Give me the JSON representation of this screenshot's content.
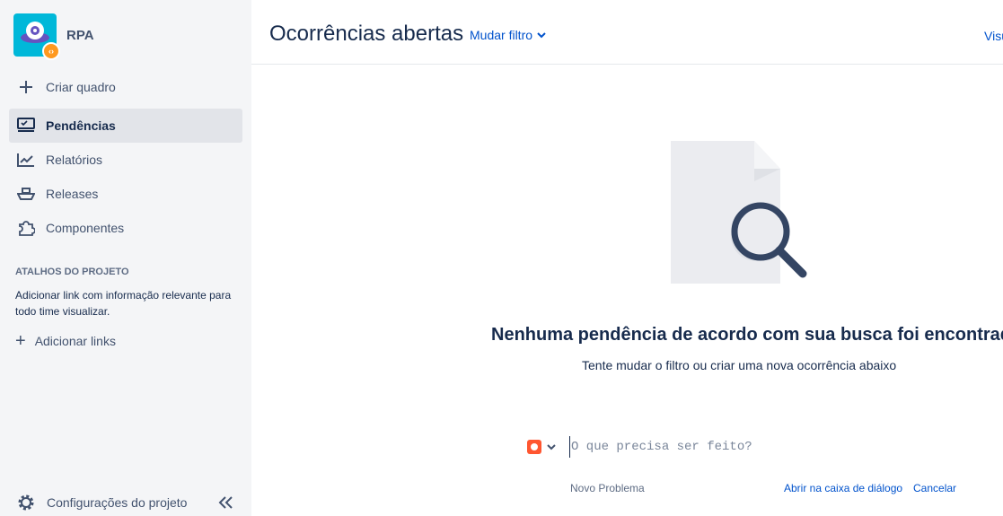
{
  "project": {
    "name": "RPA",
    "avatar_icon": "ufo-icon",
    "badge_icon": "code-icon"
  },
  "sidebar": {
    "create_board": "Criar quadro",
    "items": [
      {
        "label": "Pendências",
        "icon": "backlog-icon",
        "active": true
      },
      {
        "label": "Relatórios",
        "icon": "reports-icon",
        "active": false
      },
      {
        "label": "Releases",
        "icon": "ship-icon",
        "active": false
      },
      {
        "label": "Componentes",
        "icon": "puzzle-icon",
        "active": false
      }
    ],
    "shortcuts_title": "ATALHOS DO PROJETO",
    "shortcuts_desc": "Adicionar link com informação relevante para todo time visualizar.",
    "add_links": "Adicionar links",
    "settings": "Configurações do projeto"
  },
  "header": {
    "title": "Ocorrências abertas",
    "filter_label": "Mudar filtro",
    "visualize_label": "Visu"
  },
  "empty_state": {
    "title": "Nenhuma pendência de acordo com sua busca foi encontrada",
    "subtitle": "Tente mudar o filtro ou criar uma nova ocorrência abaixo"
  },
  "create_issue": {
    "placeholder": "O que precisa ser feito?",
    "issue_type": "Novo Problema",
    "open_dialog": "Abrir na caixa de diálogo",
    "cancel": "Cancelar"
  },
  "colors": {
    "sidebar_bg": "#f4f5f7",
    "link": "#0052cc",
    "bug": "#ff5630",
    "avatar": "#00b8d9"
  }
}
